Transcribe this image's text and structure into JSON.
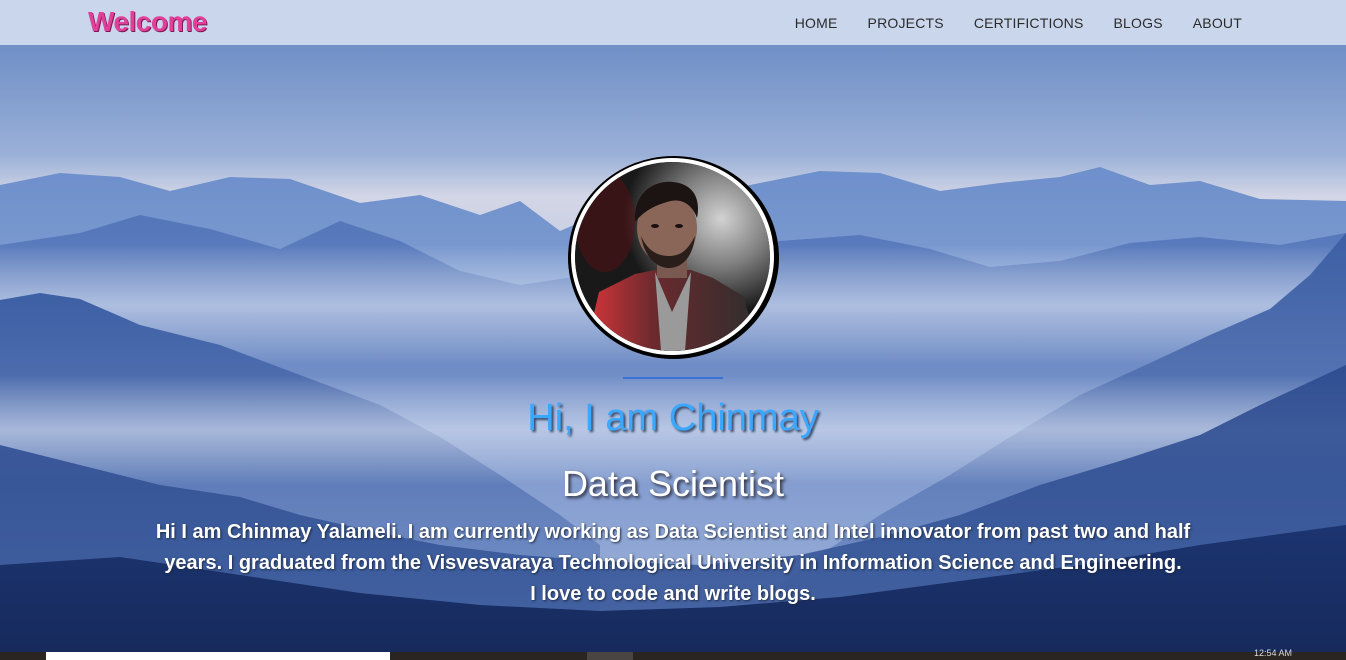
{
  "header": {
    "brand": "Welcome",
    "nav": [
      "HOME",
      "PROJECTS",
      "CERTIFICTIONS",
      "BLOGS",
      "ABOUT"
    ]
  },
  "hero": {
    "greeting": "Hi, I am Chinmay",
    "role": "Data Scientist",
    "bio_lines": [
      "Hi I am Chinmay Yalameli. I am currently working as Data Scientist and Intel innovator from past two and half",
      "years. I graduated from the Visvesvaraya Technological University in Information Science and Engineering.",
      "I love to code and write blogs."
    ]
  },
  "taskbar": {
    "clock": "12:54 AM"
  },
  "colors": {
    "brand": "#e0409a",
    "greeting": "#3aa8ff",
    "header_bg": "#c9d6ec",
    "divider": "#3b72d8"
  }
}
